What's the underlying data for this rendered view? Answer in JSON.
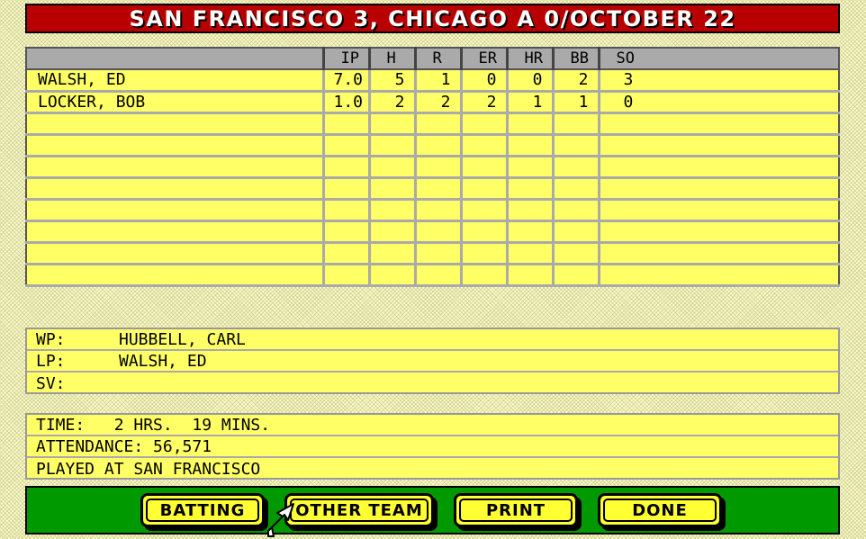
{
  "title": "SAN FRANCISCO 3, CHICAGO A 0/OCTOBER 22",
  "table": {
    "headers": [
      "",
      "IP",
      "H",
      "R",
      "ER",
      "HR",
      "BB",
      "SO"
    ],
    "rows": [
      [
        "WALSH, ED",
        "7.0",
        "5",
        "1",
        "0",
        "0",
        "2",
        "3"
      ],
      [
        "LOCKER, BOB",
        "1.0",
        "2",
        "2",
        "2",
        "1",
        "1",
        "0"
      ],
      [
        "",
        "",
        "",
        "",
        "",
        "",
        "",
        ""
      ],
      [
        "",
        "",
        "",
        "",
        "",
        "",
        "",
        ""
      ],
      [
        "",
        "",
        "",
        "",
        "",
        "",
        "",
        ""
      ],
      [
        "",
        "",
        "",
        "",
        "",
        "",
        "",
        ""
      ],
      [
        "",
        "",
        "",
        "",
        "",
        "",
        "",
        ""
      ],
      [
        "",
        "",
        "",
        "",
        "",
        "",
        "",
        ""
      ],
      [
        "",
        "",
        "",
        "",
        "",
        "",
        "",
        ""
      ],
      [
        "",
        "",
        "",
        "",
        "",
        "",
        "",
        ""
      ]
    ]
  },
  "decisions": {
    "wp_label": "WP:",
    "wp_value": "HUBBELL, CARL",
    "lp_label": "LP:",
    "lp_value": "WALSH, ED",
    "sv_label": "SV:",
    "sv_value": ""
  },
  "game_info": {
    "time": "TIME:   2 HRS.  19 MINS.",
    "attendance": "ATTENDANCE: 56,571",
    "location": "PLAYED AT SAN FRANCISCO"
  },
  "buttons": {
    "batting": "BATTING",
    "other_team": "OTHER TEAM",
    "print": "PRINT",
    "done": "DONE"
  },
  "colors": {
    "title_bg": "#b80000",
    "panel_bg": "#ffff66",
    "button_bar_bg": "#009900",
    "button_bg": "#ffff33"
  },
  "icons": {
    "cursor": "arrow-cursor-icon"
  }
}
